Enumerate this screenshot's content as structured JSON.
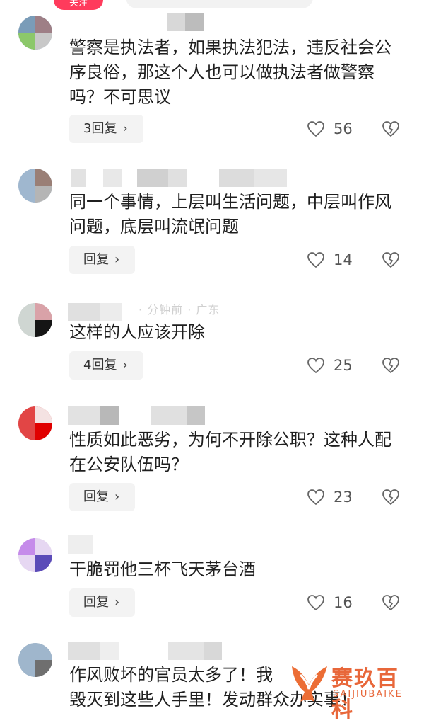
{
  "header": {
    "follow_label": "关注"
  },
  "comments": [
    {
      "text": "警察是执法者，如果执法犯法，违反社会公序良俗，那这个人也可以做执法者做警察吗？不可思议",
      "reply_label": "3回复",
      "likes": "56"
    },
    {
      "text": "同一个事情，上层叫生活问题，中层叫作风问题，底层叫流氓问题",
      "reply_label": "回复",
      "likes": "14"
    },
    {
      "meta": "· 分钟前 · 广东",
      "text": "这样的人应该开除",
      "reply_label": "4回复",
      "likes": "25"
    },
    {
      "text": "性质如此恶劣，为何不开除公职？这种人配在公安队伍吗？",
      "reply_label": "回复",
      "likes": "23"
    },
    {
      "text": "干脆罚他三杯飞天茅台酒",
      "reply_label": "回复",
      "likes": "16"
    },
    {
      "text": "作风败坏的官员太多了！我\n毁灭到这些人手里！发动群众办实事！"
    }
  ],
  "icons": {
    "like": "heart-outline-icon",
    "dislike": "broken-heart-icon",
    "reply_more": "chevron-right-icon"
  },
  "watermark": {
    "title": "赛玖百科",
    "subtitle": "SAIJIUBAIKE"
  },
  "colors": {
    "accent": "#ff3b5c",
    "watermark": "#e8673a",
    "reply_bg": "#f3f3f3"
  }
}
